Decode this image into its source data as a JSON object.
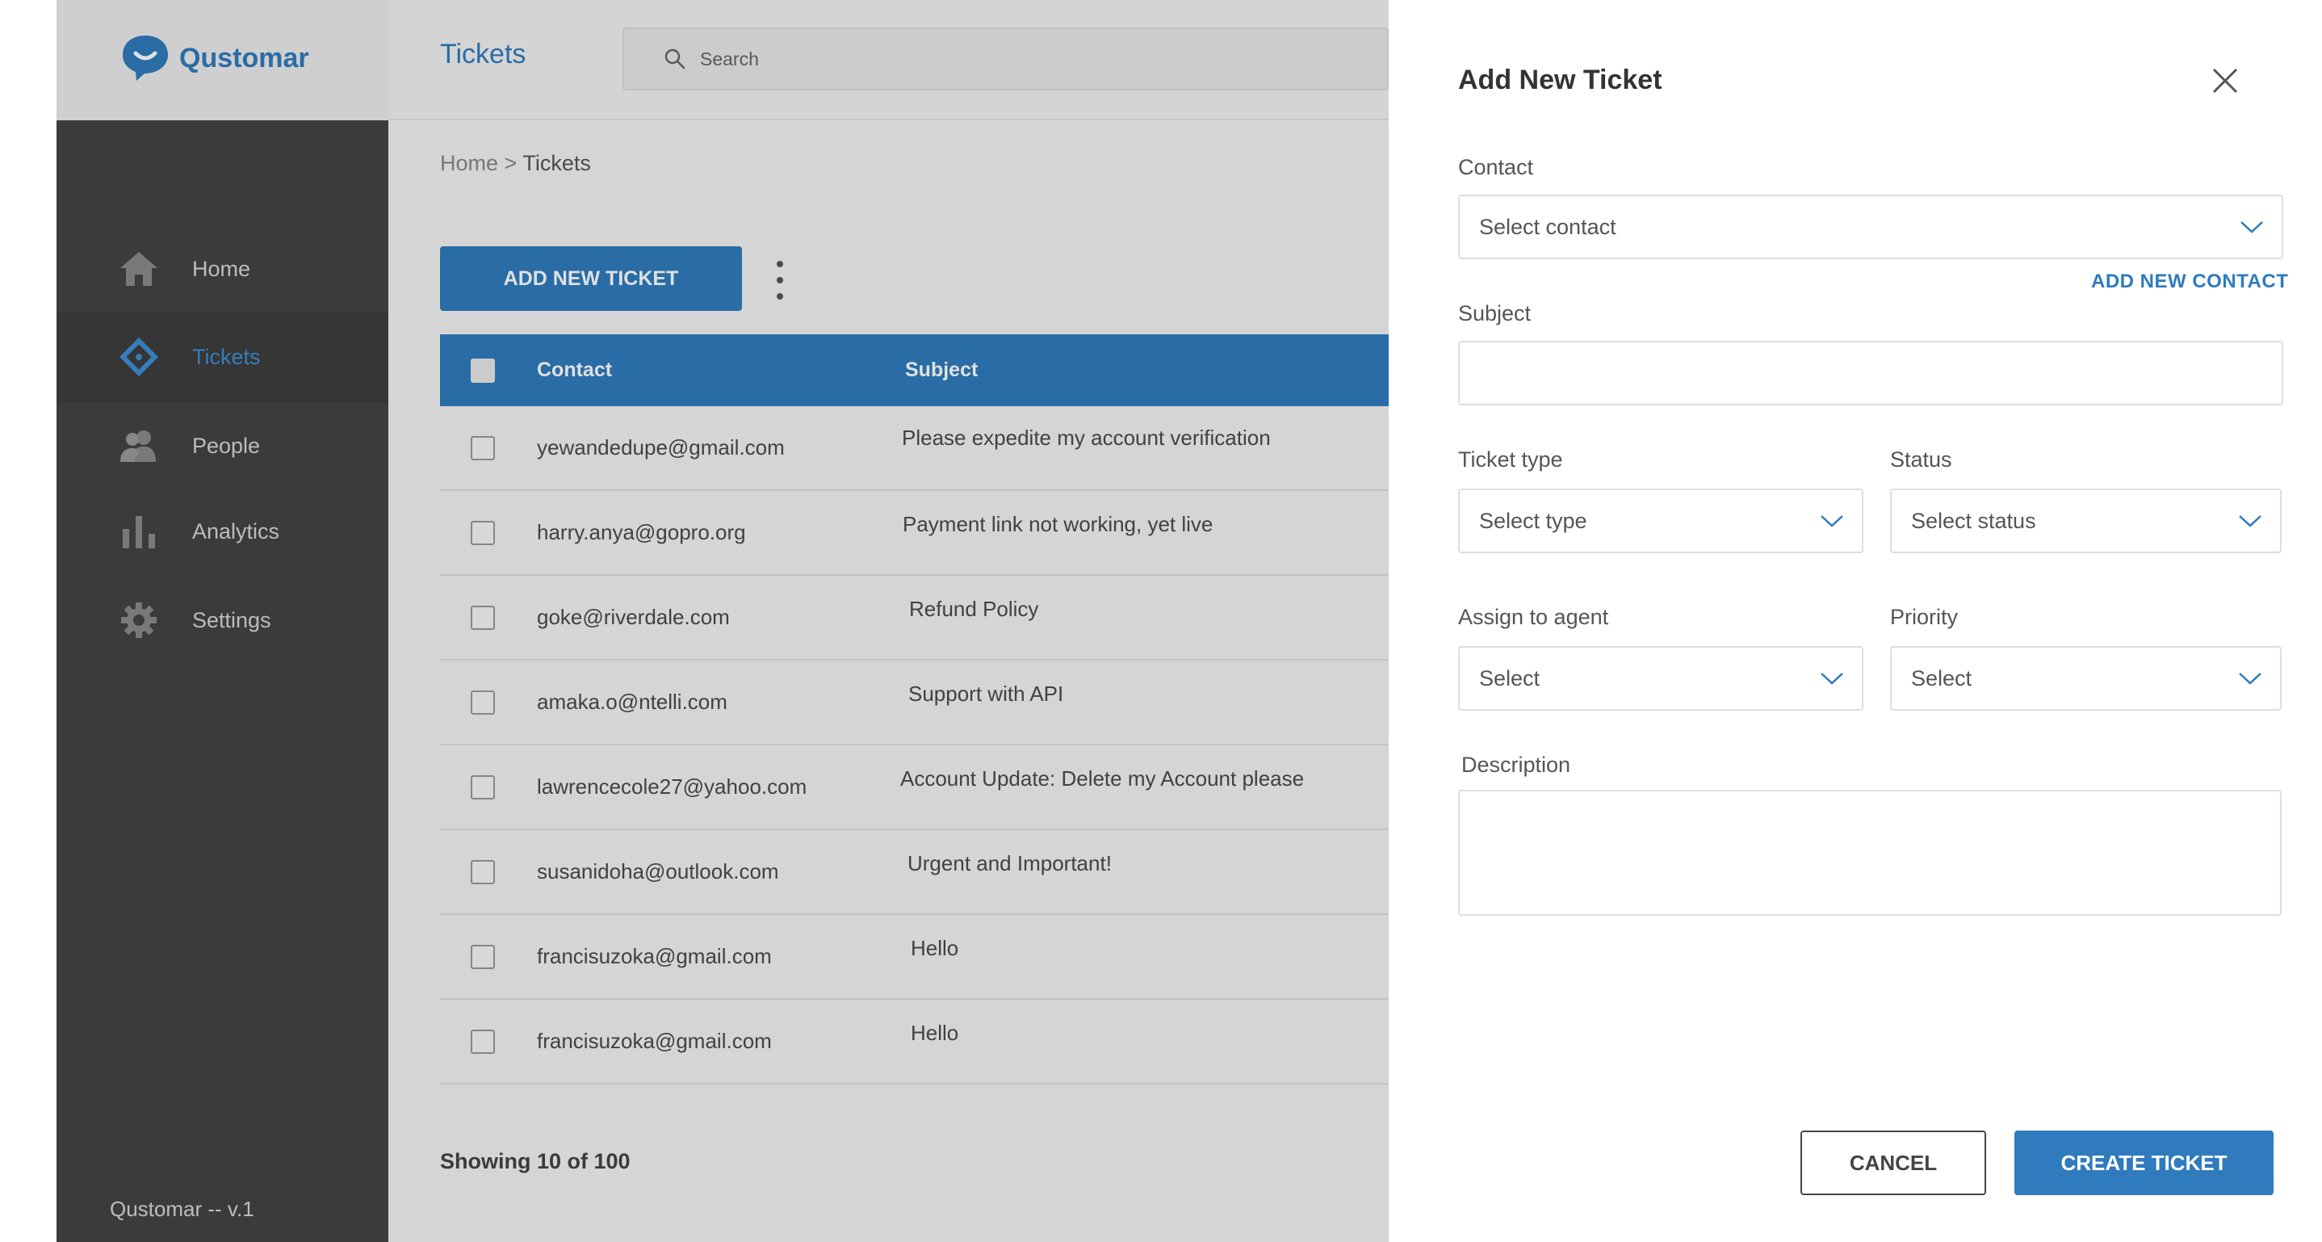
{
  "app": {
    "brand": "Qustomar",
    "page_title": "Tickets",
    "version": "Qustomar  -- v.1"
  },
  "search": {
    "placeholder": "Search"
  },
  "sidebar": {
    "items": [
      {
        "label": "Home",
        "icon": "home-icon"
      },
      {
        "label": "Tickets",
        "icon": "ticket-icon",
        "active": true
      },
      {
        "label": "People",
        "icon": "people-icon"
      },
      {
        "label": "Analytics",
        "icon": "analytics-icon"
      },
      {
        "label": "Settings",
        "icon": "gear-icon"
      }
    ]
  },
  "breadcrumb": {
    "home": "Home",
    "separator": ">",
    "current": "Tickets"
  },
  "toolbar": {
    "add_ticket": "ADD NEW TICKET"
  },
  "table": {
    "headers": {
      "contact": "Contact",
      "subject": "Subject"
    },
    "rows": [
      {
        "contact": "yewandedupe@gmail.com",
        "subject": "Please expedite my account verification"
      },
      {
        "contact": "harry.anya@gopro.org",
        "subject": "Payment link not working, yet live"
      },
      {
        "contact": "goke@riverdale.com",
        "subject": "Refund Policy"
      },
      {
        "contact": "amaka.o@ntelli.com",
        "subject": "Support with API"
      },
      {
        "contact": "lawrencecole27@yahoo.com",
        "subject": "Account Update: Delete my Account please"
      },
      {
        "contact": "susanidoha@outlook.com",
        "subject": "Urgent and Important!"
      },
      {
        "contact": "francisuzoka@gmail.com",
        "subject": "Hello"
      },
      {
        "contact": "francisuzoka@gmail.com",
        "subject": "Hello"
      }
    ]
  },
  "pagination": {
    "showing": "Showing 10 of 100"
  },
  "drawer": {
    "title": "Add New Ticket",
    "contact": {
      "label": "Contact",
      "placeholder": "Select contact"
    },
    "add_contact": "ADD NEW CONTACT",
    "subject": {
      "label": "Subject",
      "value": ""
    },
    "ticket_type": {
      "label": "Ticket type",
      "placeholder": "Select type"
    },
    "status": {
      "label": "Status",
      "placeholder": "Select status"
    },
    "agent": {
      "label": "Assign to agent",
      "placeholder": "Select"
    },
    "priority": {
      "label": "Priority",
      "placeholder": "Select"
    },
    "description": {
      "label": "Description",
      "value": ""
    },
    "cancel": "CANCEL",
    "create": "CREATE TICKET"
  },
  "colors": {
    "accent": "#2f7bbd",
    "sidebar": "#444444"
  }
}
